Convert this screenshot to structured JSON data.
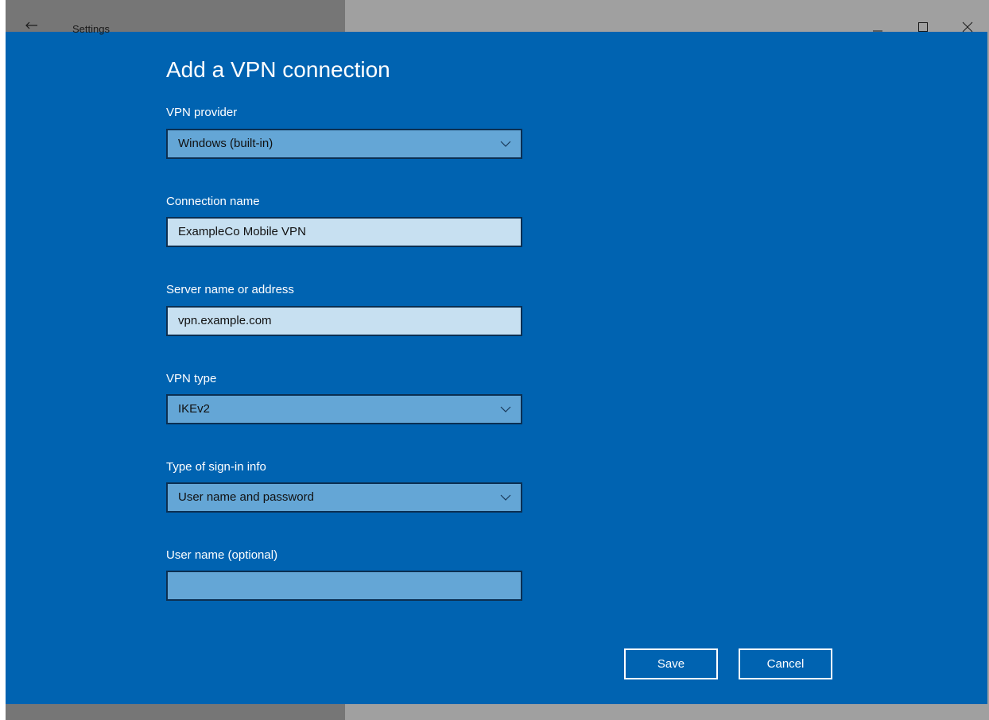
{
  "window": {
    "title": "Settings",
    "back_icon": "back-arrow-icon",
    "minimize_icon": "minimize-icon",
    "maximize_icon": "maximize-icon",
    "close_icon": "close-icon"
  },
  "dialog": {
    "title": "Add a VPN connection",
    "background_color": "#0063b1",
    "fields": {
      "vpn_provider": {
        "label": "VPN provider",
        "value": "Windows (built-in)"
      },
      "connection_name": {
        "label": "Connection name",
        "value": "ExampleCo Mobile VPN"
      },
      "server": {
        "label": "Server name or address",
        "value": "vpn.example.com"
      },
      "vpn_type": {
        "label": "VPN type",
        "value": "IKEv2"
      },
      "sign_in_type": {
        "label": "Type of sign-in info",
        "value": "User name and password"
      },
      "user_name": {
        "label": "User name (optional)",
        "value": ""
      }
    },
    "buttons": {
      "save": "Save",
      "cancel": "Cancel"
    }
  }
}
